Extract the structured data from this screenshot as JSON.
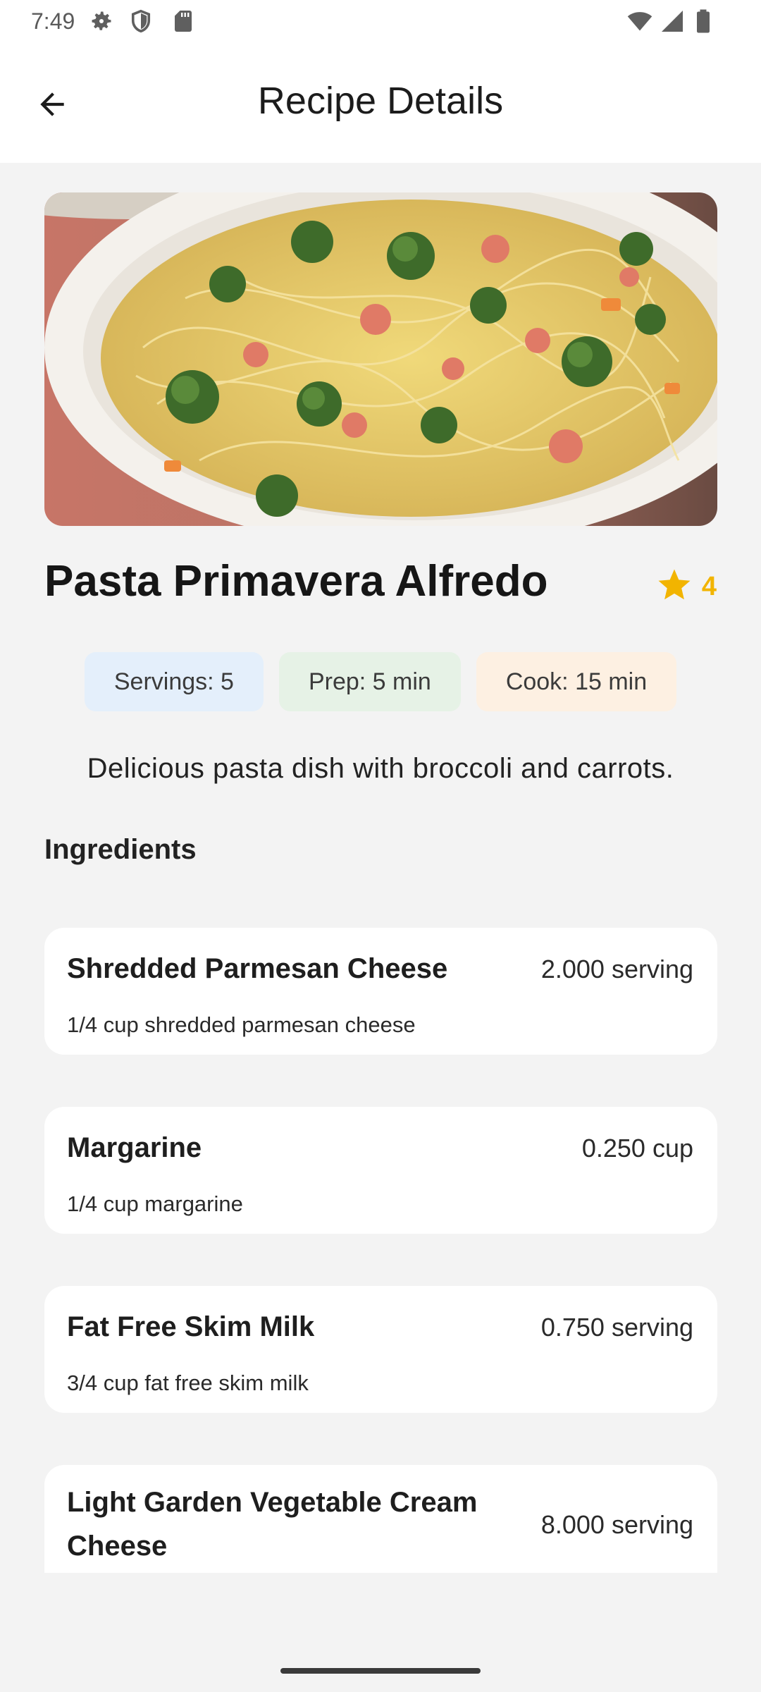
{
  "status_bar": {
    "time": "7:49",
    "icons": [
      "gear-icon",
      "shield-icon",
      "sd-card-icon",
      "wifi-icon",
      "signal-icon",
      "battery-icon"
    ]
  },
  "app_bar": {
    "title": "Recipe Details",
    "back_icon": "arrow-back-icon"
  },
  "recipe": {
    "image_alt": "Pasta Primavera Alfredo",
    "title": "Pasta Primavera Alfredo",
    "rating": "4",
    "servings": "Servings: 5",
    "prep": "Prep: 5 min",
    "cook": "Cook: 15 min",
    "description": "Delicious pasta dish with broccoli and carrots."
  },
  "ingredients_section": {
    "heading": "Ingredients",
    "items": [
      {
        "name": "Shredded Parmesan Cheese",
        "amount": "2.000 serving",
        "desc": "1/4 cup shredded parmesan cheese"
      },
      {
        "name": "Margarine",
        "amount": "0.250 cup",
        "desc": "1/4 cup margarine"
      },
      {
        "name": "Fat Free Skim Milk",
        "amount": "0.750 serving",
        "desc": "3/4 cup fat free skim milk"
      },
      {
        "name": "Light Garden Vegetable Cream Cheese",
        "amount": "8.000 serving",
        "desc": ""
      }
    ]
  },
  "colors": {
    "accent_star": "#f2b400",
    "chip_servings": "#e4effb",
    "chip_prep": "#e6f2e6",
    "chip_cook": "#fdf0e2"
  }
}
